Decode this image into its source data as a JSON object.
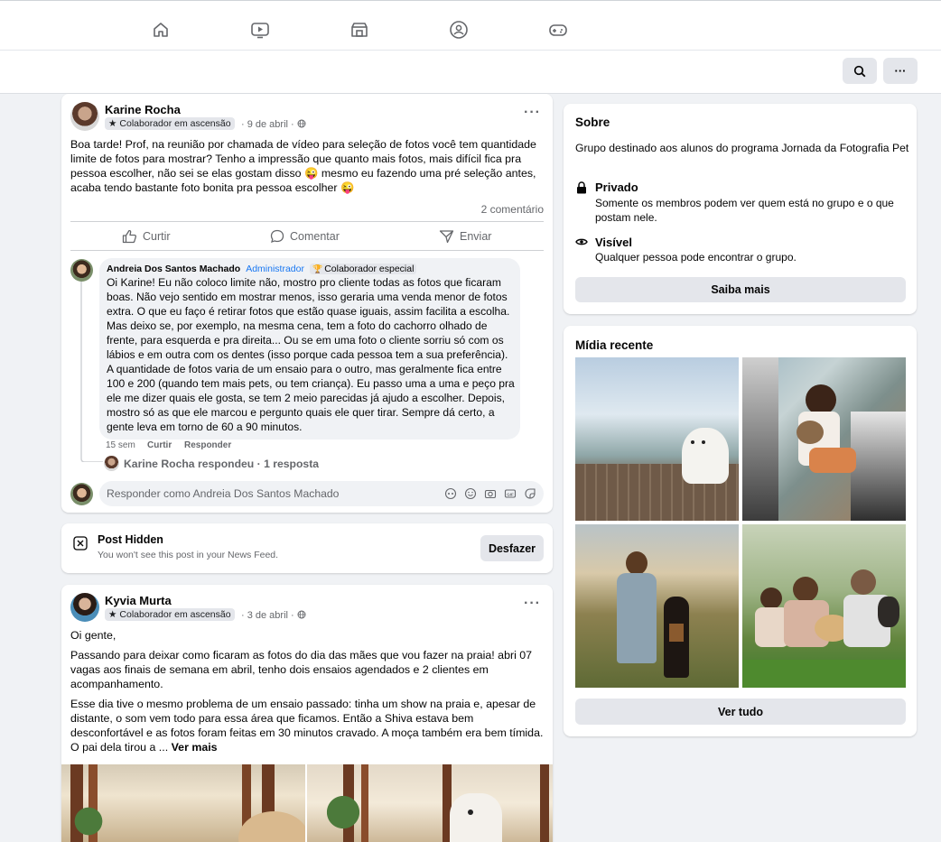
{
  "nav": {
    "icons": [
      "home-icon",
      "watch-icon",
      "marketplace-icon",
      "groups-icon",
      "gaming-icon"
    ]
  },
  "subbar": {
    "search_icon": "search-icon",
    "more_label": "···"
  },
  "post1": {
    "author": "Karine Rocha",
    "badge": "Colaborador em ascensão",
    "date": "· 9 de abril ·",
    "more": "···",
    "text": "Boa tarde! Prof, na reunião por chamada de vídeo para seleção de fotos você tem quantidade limite de fotos para mostrar? Tenho a impressão que quanto mais fotos, mais difícil fica pra pessoa escolher, não sei se elas gostam disso 😜 mesmo eu fazendo uma pré seleção antes, acaba tendo bastante foto bonita pra pessoa escolher 😜",
    "comment_count": "2 comentário",
    "actions": {
      "like": "Curtir",
      "comment": "Comentar",
      "send": "Enviar"
    },
    "comment": {
      "author": "Andreia Dos Santos Machado",
      "role": "Administrador",
      "badge": "Colaborador especial",
      "text": "Oi Karine! Eu não coloco limite não, mostro pro cliente todas as fotos que ficaram boas. Não vejo sentido em mostrar menos, isso geraria uma venda menor de fotos extra. O que eu faço é retirar fotos que estão quase iguais, assim facilita a escolha. Mas deixo se, por exemplo, na mesma cena, tem a foto do cachorro olhado de frente, para esquerda e pra direita... Ou se em uma foto o cliente sorriu só com os lábios e em outra com os dentes (isso porque cada pessoa tem a sua preferência). A quantidade de fotos varia de um ensaio para o outro, mas geralmente fica entre 100 e 200 (quando tem mais pets, ou tem criança). Eu passo uma a uma e peço pra ele me dizer quais ele gosta, se tem 2 meio parecidas já ajudo a escolher. Depois, mostro só as que ele marcou e pergunto quais ele quer tirar. Sempre dá certo, a gente leva em torno de 60 a 90 minutos.",
      "time": "15 sem",
      "like": "Curtir",
      "reply": "Responder"
    },
    "reply_summary": "Karine Rocha respondeu · 1 resposta",
    "reply_placeholder": "Responder como Andreia Dos Santos Machado"
  },
  "hidden": {
    "title": "Post Hidden",
    "subtitle": "You won't see this post in your News Feed.",
    "undo": "Desfazer"
  },
  "post2": {
    "author": "Kyvia Murta",
    "badge": "Colaborador em ascensão",
    "date": "· 3 de abril ·",
    "more": "···",
    "p1": "Oi gente,",
    "p2": "Passando para deixar como ficaram as fotos do dia das mães que vou fazer na praia! abri 07 vagas aos finais de semana em abril, tenho dois ensaios agendados e 2 clientes em acompanhamento.",
    "p3": "Esse dia tive o mesmo problema de um ensaio passado: tinha um show na praia e, apesar de distante, o som vem todo para essa área que ficamos. Então a Shiva estava bem desconfortável e as fotos foram feitas em 30 minutos cravado. A moça também era bem tímida. O pai dela tirou a ...",
    "see_more": "Ver mais"
  },
  "about": {
    "title": "Sobre",
    "description": "Grupo destinado aos alunos do programa Jornada da Fotografia Pet",
    "private_title": "Privado",
    "private_desc": "Somente os membros podem ver quem está no grupo e o que postam nele.",
    "visible_title": "Visível",
    "visible_desc": "Qualquer pessoa pode encontrar o grupo.",
    "button": "Saiba mais"
  },
  "media": {
    "title": "Mídia recente",
    "button": "Ver tudo"
  },
  "colors": {
    "accent": "#1877f2",
    "background": "#f0f2f5",
    "secondary_text": "#65676b"
  }
}
